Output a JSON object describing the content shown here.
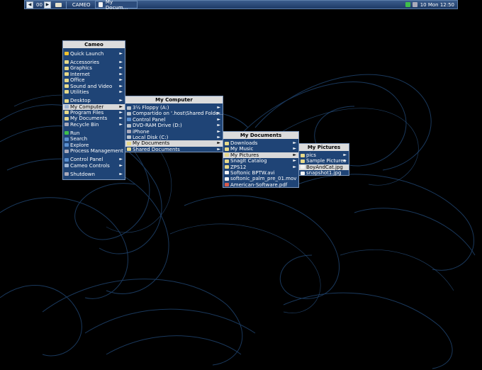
{
  "taskbar": {
    "desktop_num": "00",
    "app_name": "CAMEO",
    "task_label": "My Docum...",
    "clock": "10 Mon 12:50"
  },
  "start_menu": {
    "title": "Cameo",
    "groups": [
      [
        {
          "label": "Quick Launch",
          "icon": "star-icon",
          "submenu": true
        }
      ],
      [
        {
          "label": "Accessories",
          "icon": "folder-icon",
          "submenu": true
        },
        {
          "label": "Graphics",
          "icon": "folder-icon",
          "submenu": true
        },
        {
          "label": "Internet",
          "icon": "folder-icon",
          "submenu": true
        },
        {
          "label": "Office",
          "icon": "folder-icon",
          "submenu": true
        },
        {
          "label": "Sound and Video",
          "icon": "folder-icon",
          "submenu": true
        },
        {
          "label": "Utilities",
          "icon": "folder-icon",
          "submenu": true
        }
      ],
      [
        {
          "label": "Desktop",
          "icon": "folder-icon",
          "submenu": true
        },
        {
          "label": "My Computer",
          "icon": "computer-icon",
          "submenu": true,
          "selected": true
        },
        {
          "label": "Program Files",
          "icon": "folder-icon",
          "submenu": true
        },
        {
          "label": "My Documents",
          "icon": "folder-icon",
          "submenu": true
        },
        {
          "label": "Recycle Bin",
          "icon": "recycle-bin-icon",
          "submenu": true
        }
      ],
      [
        {
          "label": "Run",
          "icon": "run-icon",
          "submenu": false
        },
        {
          "label": "Search",
          "icon": "search-icon",
          "submenu": false
        },
        {
          "label": "Explore",
          "icon": "explore-icon",
          "submenu": false
        },
        {
          "label": "Process Management",
          "icon": "process-icon",
          "submenu": false
        }
      ],
      [
        {
          "label": "Control Panel",
          "icon": "control-panel-icon",
          "submenu": true
        },
        {
          "label": "Cameo Controls",
          "icon": "cameo-controls-icon",
          "submenu": true
        }
      ],
      [
        {
          "label": "Shutdown",
          "icon": "shutdown-icon",
          "submenu": true
        }
      ]
    ]
  },
  "my_computer_menu": {
    "title": "My Computer",
    "items": [
      {
        "label": "3½ Floppy (A:)",
        "icon": "floppy-icon",
        "submenu": true
      },
      {
        "label": "Compartido on '.host\\Shared Folde...",
        "icon": "network-drive-icon",
        "submenu": true
      },
      {
        "label": "Control Panel",
        "icon": "control-panel-icon",
        "submenu": true
      },
      {
        "label": "DVD-RAM Drive (D:)",
        "icon": "dvd-drive-icon",
        "submenu": true
      },
      {
        "label": "iPhone",
        "icon": "phone-icon",
        "submenu": true
      },
      {
        "label": "Local Disk (C:)",
        "icon": "disk-icon",
        "submenu": true
      },
      {
        "label": "My Documents",
        "icon": "folder-icon",
        "submenu": true,
        "selected": true
      },
      {
        "label": "Shared Documents",
        "icon": "folder-icon",
        "submenu": true
      }
    ]
  },
  "my_documents_menu": {
    "title": "My Documents",
    "items": [
      {
        "label": "Downloads",
        "icon": "folder-icon",
        "submenu": true
      },
      {
        "label": "My Music",
        "icon": "folder-icon",
        "submenu": true
      },
      {
        "label": "My Pictures",
        "icon": "folder-icon",
        "submenu": true,
        "selected": true
      },
      {
        "label": "SnagIt Catalog",
        "icon": "folder-icon",
        "submenu": true
      },
      {
        "label": "ZPS12",
        "icon": "folder-icon",
        "submenu": true
      },
      {
        "label": "Softonic BPTW.avi",
        "icon": "video-file-icon",
        "submenu": false
      },
      {
        "label": "softonic_palm_pre_01.mov",
        "icon": "video-file-icon",
        "submenu": false
      },
      {
        "label": "American-Software.pdf",
        "icon": "pdf-file-icon",
        "submenu": false
      }
    ]
  },
  "my_pictures_menu": {
    "title": "My Pictures",
    "items": [
      {
        "label": "pics",
        "icon": "folder-icon",
        "submenu": true
      },
      {
        "label": "Sample Pictures",
        "icon": "folder-icon",
        "submenu": true
      },
      {
        "label": "BoyAndCat.jpg",
        "icon": "image-file-icon",
        "submenu": false,
        "selected": true
      },
      {
        "label": "snapshot1.jpg",
        "icon": "image-file-icon",
        "submenu": false
      }
    ]
  }
}
